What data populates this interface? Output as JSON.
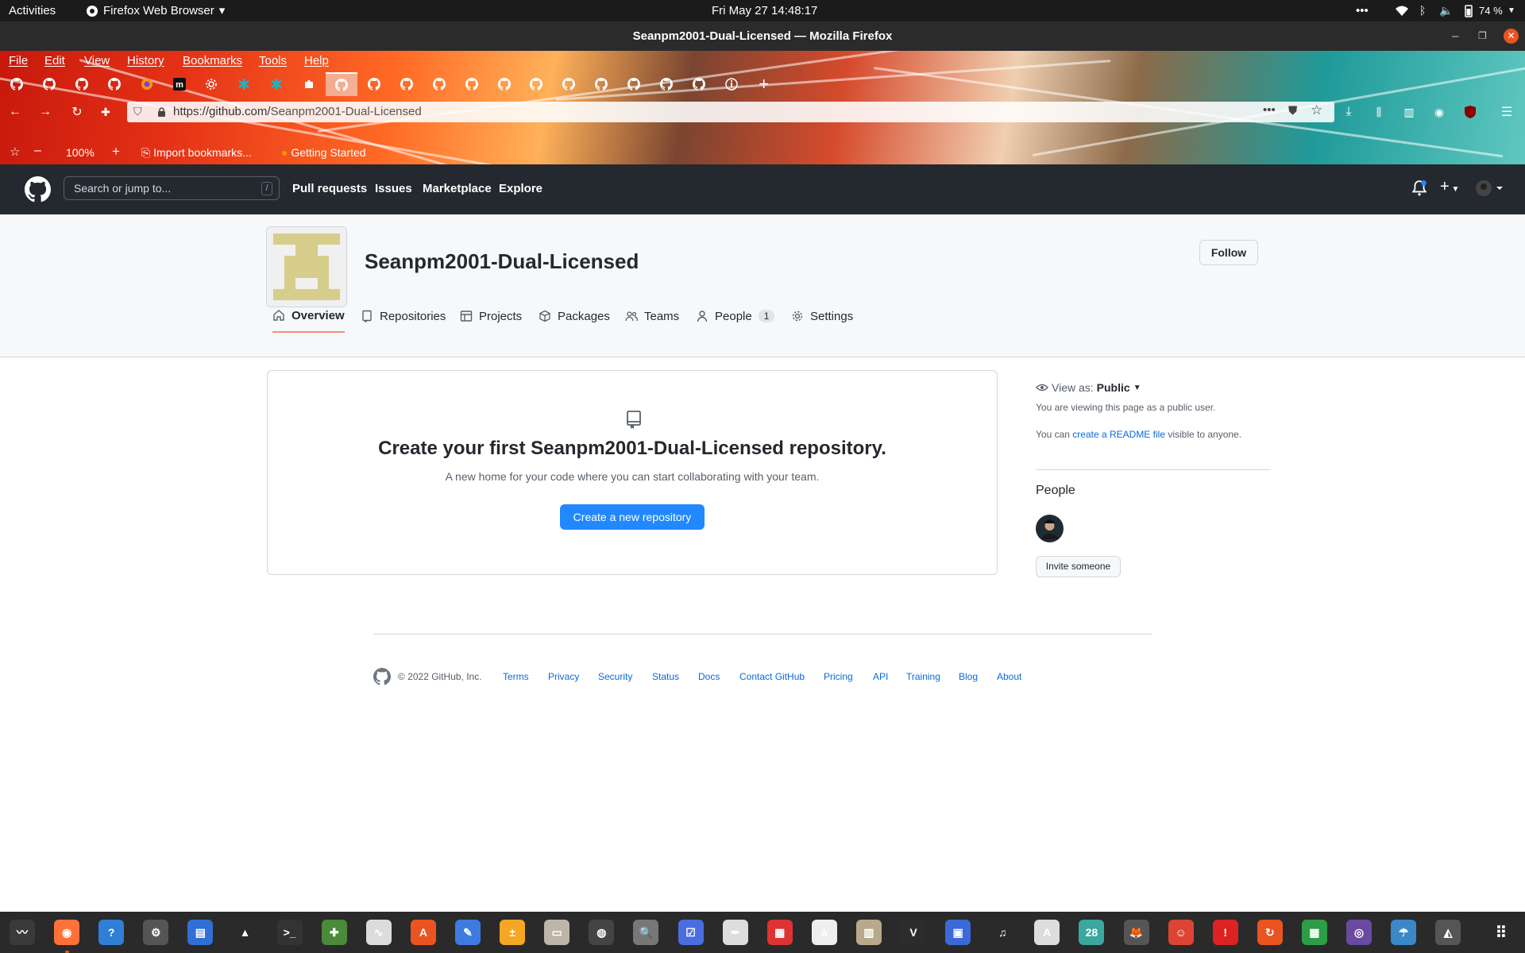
{
  "topbar": {
    "activities": "Activities",
    "app": "Firefox Web Browser",
    "clock": "Fri May 27  14:48:17",
    "battery": "74 %"
  },
  "window": {
    "title": "Seanpm2001-Dual-Licensed — Mozilla Firefox"
  },
  "menu": [
    "File",
    "Edit",
    "View",
    "History",
    "Bookmarks",
    "Tools",
    "Help"
  ],
  "tabs": [
    {
      "icon": "github-icon"
    },
    {
      "icon": "github-icon"
    },
    {
      "icon": "github-icon"
    },
    {
      "icon": "github-icon"
    },
    {
      "icon": "firefox-icon"
    },
    {
      "icon": "m-icon"
    },
    {
      "icon": "gear-icon"
    },
    {
      "icon": "teal-asterisk-icon"
    },
    {
      "icon": "teal-asterisk-icon"
    },
    {
      "icon": "puzzle-icon"
    },
    {
      "icon": "github-icon",
      "active": true
    },
    {
      "icon": "github-icon"
    },
    {
      "icon": "github-icon"
    },
    {
      "icon": "github-icon"
    },
    {
      "icon": "github-icon"
    },
    {
      "icon": "github-icon"
    },
    {
      "icon": "github-icon"
    },
    {
      "icon": "github-icon"
    },
    {
      "icon": "github-icon"
    },
    {
      "icon": "github-icon"
    },
    {
      "icon": "github-icon"
    },
    {
      "icon": "github-icon"
    },
    {
      "icon": "info-icon"
    }
  ],
  "nav": {
    "url_host": "https://github.com/",
    "url_path": "Seanpm2001-Dual-Licensed"
  },
  "bookmarks": {
    "zoom": "100%",
    "import": "Import bookmarks...",
    "getting_started": "Getting Started"
  },
  "gh": {
    "search_placeholder": "Search or jump to...",
    "slash": "/",
    "nav": [
      "Pull requests",
      "Issues",
      "Marketplace",
      "Explore"
    ]
  },
  "org": {
    "name": "Seanpm2001-Dual-Licensed",
    "follow": "Follow"
  },
  "org_tabs": [
    {
      "label": "Overview",
      "icon": "home-icon",
      "active": true
    },
    {
      "label": "Repositories",
      "icon": "repo-icon"
    },
    {
      "label": "Projects",
      "icon": "table-icon"
    },
    {
      "label": "Packages",
      "icon": "package-icon"
    },
    {
      "label": "Teams",
      "icon": "people-icon"
    },
    {
      "label": "People",
      "icon": "person-icon",
      "count": "1"
    },
    {
      "label": "Settings",
      "icon": "gear-icon"
    }
  ],
  "empty": {
    "title": "Create your first Seanpm2001-Dual-Licensed repository.",
    "subtitle": "A new home for your code where you can start collaborating with your team.",
    "button": "Create a new repository"
  },
  "sidebar": {
    "view_as_label": "View as:",
    "view_as_value": "Public",
    "viewing_note": "You are viewing this page as a public user.",
    "readme_pre": "You can",
    "readme_link": "create a README file",
    "readme_post": "visible to anyone.",
    "people_title": "People",
    "invite": "Invite someone"
  },
  "footer": {
    "copyright": "© 2022 GitHub, Inc.",
    "links": [
      "Terms",
      "Privacy",
      "Security",
      "Status",
      "Docs",
      "Contact GitHub",
      "Pricing",
      "API",
      "Training",
      "Blog",
      "About"
    ]
  },
  "dock": {
    "calendar_day": "28"
  },
  "colors": {
    "gh_header": "#24292f",
    "primary_button": "#2188ff",
    "link": "#0969da",
    "active_tab_underline": "#fd8c73"
  }
}
